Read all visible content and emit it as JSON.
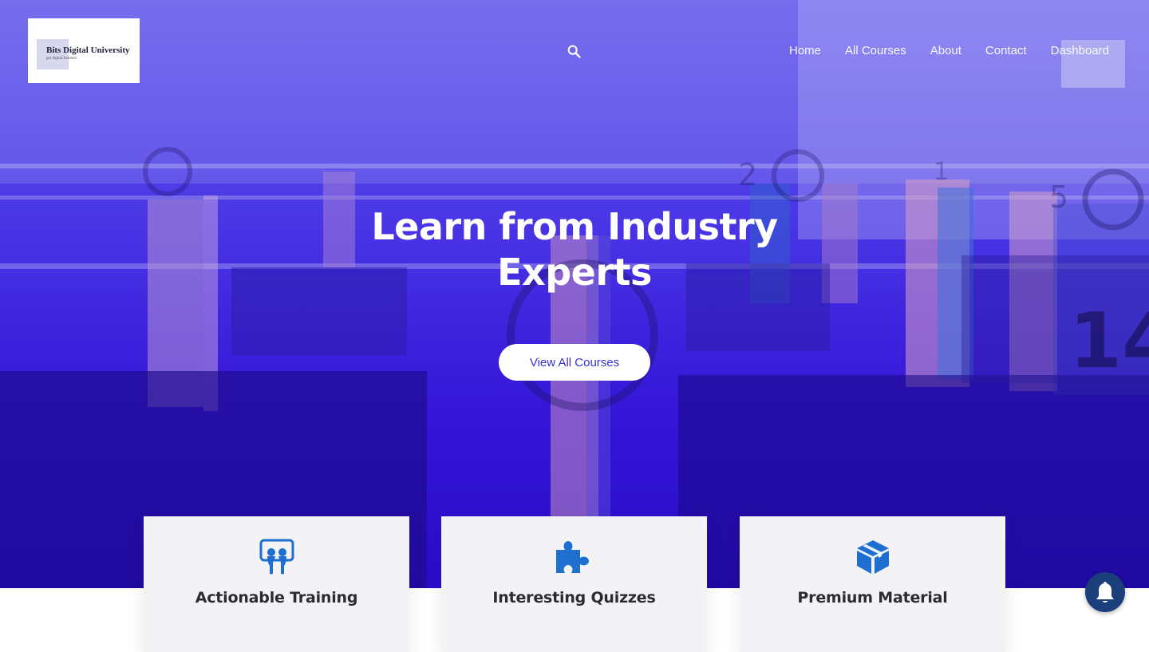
{
  "brand": {
    "name": "Bits Digital University",
    "tagline": "get digital freedom",
    "logo_bg": "#ffffff"
  },
  "header": {
    "search_icon": "search-icon",
    "nav": [
      {
        "label": "Home"
      },
      {
        "label": "All Courses"
      },
      {
        "label": "About"
      },
      {
        "label": "Contact"
      },
      {
        "label": "Dashboard"
      }
    ]
  },
  "hero": {
    "headline_line1": "Learn from Industry",
    "headline_line2": "Experts",
    "cta_label": "View All Courses",
    "overlay_color": "#3a1fd9"
  },
  "features": [
    {
      "icon": "slideshare-icon",
      "title": "Actionable Training"
    },
    {
      "icon": "puzzle-icon",
      "title": "Interesting Quizzes"
    },
    {
      "icon": "cube-icon",
      "title": "Premium Material"
    }
  ],
  "colors": {
    "accent": "#1e6fd0",
    "cta_text": "#3730d6",
    "bell_bg": "#1b3f7a",
    "card_bg": "#f3f3f5"
  },
  "notification": {
    "icon": "bell-icon"
  }
}
